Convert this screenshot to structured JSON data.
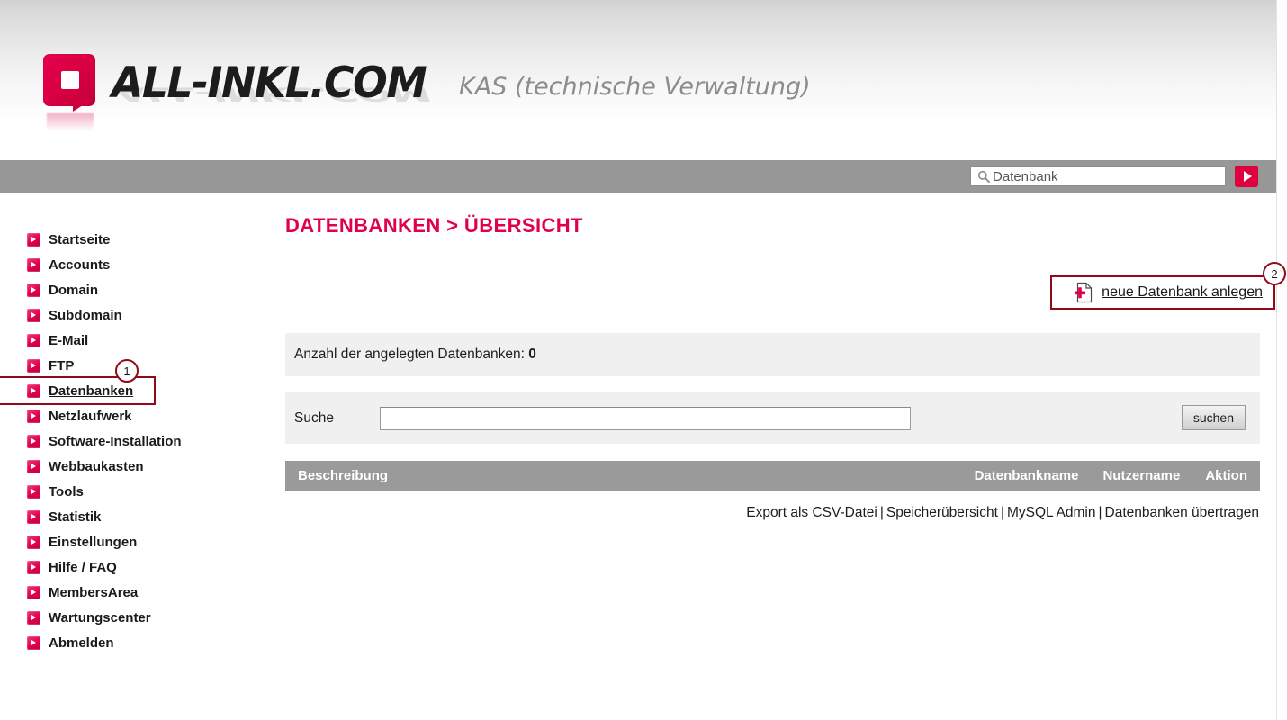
{
  "brand": {
    "wordmark": "ALL-INKL.COM",
    "subtitle": "KAS (technische Verwaltung)",
    "logo_color": "#e0004b",
    "accent_color": "#e2004b"
  },
  "topbar": {
    "search_value": "Datenbank",
    "search_placeholder": "Datenbank",
    "search_icon": "magnifier-icon",
    "go_icon": "play-arrow-icon",
    "background_color": "#979797"
  },
  "sidebar": {
    "items": [
      {
        "label": "Startseite",
        "active": false
      },
      {
        "label": "Accounts",
        "active": false
      },
      {
        "label": "Domain",
        "active": false
      },
      {
        "label": "Subdomain",
        "active": false
      },
      {
        "label": "E-Mail",
        "active": false
      },
      {
        "label": "FTP",
        "active": false
      },
      {
        "label": "Datenbanken",
        "active": true
      },
      {
        "label": "Netzlaufwerk",
        "active": false
      },
      {
        "label": "Software-Installation",
        "active": false
      },
      {
        "label": "Webbaukasten",
        "active": false
      },
      {
        "label": "Tools",
        "active": false
      },
      {
        "label": "Statistik",
        "active": false
      },
      {
        "label": "Einstellungen",
        "active": false
      },
      {
        "label": "Hilfe / FAQ",
        "active": false
      },
      {
        "label": "MembersArea",
        "active": false
      },
      {
        "label": "Wartungscenter",
        "active": false
      },
      {
        "label": "Abmelden",
        "active": false
      }
    ]
  },
  "annotations": {
    "badge_1": "1",
    "badge_2": "2",
    "color": "#8f0b18"
  },
  "main": {
    "title": "DATENBANKEN > ÜBERSICHT",
    "create_link": "neue Datenbank anlegen",
    "create_icon": "document-plus-icon",
    "count_label": "Anzahl der angelegten Datenbanken:",
    "count_value": "0",
    "search_label": "Suche",
    "search_value": "",
    "search_button": "suchen",
    "table": {
      "columns": [
        "Beschreibung",
        "Datenbankname",
        "Nutzername",
        "Aktion"
      ],
      "rows": []
    },
    "footer_links": [
      "Export als CSV-Datei",
      "Speicherübersicht",
      "MySQL Admin",
      "Datenbanken übertragen"
    ],
    "footer_separator": "|"
  }
}
